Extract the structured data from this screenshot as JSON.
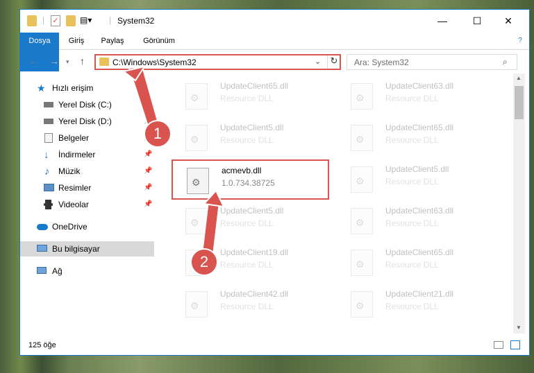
{
  "window": {
    "title": "System32"
  },
  "ribbon": {
    "tabs": [
      "Dosya",
      "Giriş",
      "Paylaş",
      "Görünüm"
    ]
  },
  "address": {
    "path": "C:\\Windows\\System32",
    "search_placeholder": "Ara: System32"
  },
  "nav": {
    "items": [
      {
        "label": "Hızlı erişim",
        "icon": "star-icon",
        "pinned": false
      },
      {
        "label": "Yerel Disk (C:)",
        "icon": "drive-icon",
        "pinned": true
      },
      {
        "label": "Yerel Disk (D:)",
        "icon": "drive-icon",
        "pinned": true
      },
      {
        "label": "Belgeler",
        "icon": "documents-icon",
        "pinned": true
      },
      {
        "label": "İndirmeler",
        "icon": "downloads-icon",
        "pinned": true
      },
      {
        "label": "Müzik",
        "icon": "music-icon",
        "pinned": true
      },
      {
        "label": "Resimler",
        "icon": "pictures-icon",
        "pinned": true
      },
      {
        "label": "Videolar",
        "icon": "videos-icon",
        "pinned": true
      },
      {
        "label": "OneDrive",
        "icon": "cloud-icon",
        "pinned": false
      },
      {
        "label": "Bu bilgisayar",
        "icon": "computer-icon",
        "pinned": false
      },
      {
        "label": "Ağ",
        "icon": "network-icon",
        "pinned": false
      }
    ]
  },
  "files": [
    {
      "name": "UpdateClient65.dll",
      "desc": "Resource DLL",
      "faded": true
    },
    {
      "name": "UpdateClient63.dll",
      "desc": "Resource DLL",
      "faded": true
    },
    {
      "name": "UpdateClient5.dll",
      "desc": "Resource DLL",
      "faded": true
    },
    {
      "name": "UpdateClient65.dll",
      "desc": "Resource DLL",
      "faded": true
    },
    {
      "name": "acmevb.dll",
      "desc": "1.0.734.38725",
      "faded": false
    },
    {
      "name": "UpdateClient5.dll",
      "desc": "Resource DLL",
      "faded": true
    },
    {
      "name": "UpdateClient5.dll",
      "desc": "Resource DLL",
      "faded": true
    },
    {
      "name": "UpdateClient63.dll",
      "desc": "Resource DLL",
      "faded": true
    },
    {
      "name": "UpdateClient19.dll",
      "desc": "Resource DLL",
      "faded": true
    },
    {
      "name": "UpdateClient65.dll",
      "desc": "Resource DLL",
      "faded": true
    },
    {
      "name": "UpdateClient42.dll",
      "desc": "Resource DLL",
      "faded": true
    },
    {
      "name": "UpdateClient21.dll",
      "desc": "Resource DLL",
      "faded": true
    }
  ],
  "status": {
    "count": "125 öğe"
  },
  "callouts": {
    "one": "1",
    "two": "2"
  },
  "colors": {
    "accent": "#1979ca",
    "highlight": "#d9534f"
  }
}
